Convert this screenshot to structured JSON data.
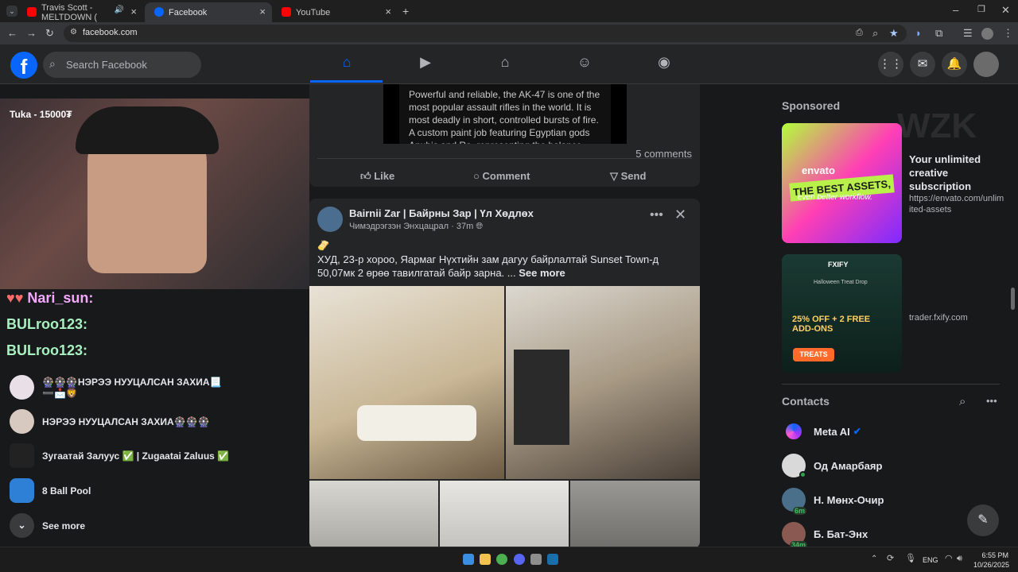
{
  "browser": {
    "tabs": [
      {
        "label": "Travis Scott - MELTDOWN (",
        "favicon_color": "#ff0000"
      },
      {
        "label": "Facebook",
        "favicon_color": "#0866ff"
      },
      {
        "label": "YouTube",
        "favicon_color": "#ff0000"
      }
    ],
    "url": "facebook.com"
  },
  "fb": {
    "logo": "f",
    "search_placeholder": "Search Facebook",
    "accent": "#0866ff"
  },
  "left": {
    "stream_overlay": "Tuka - 15000₮",
    "chat": [
      {
        "user": "Nari_sun:"
      },
      {
        "user": "BULroo123:"
      },
      {
        "user": "BULroo123:"
      }
    ],
    "shortcuts": [
      {
        "label": "🎡🎡🎡НЭРЭЭ НУУЦАЛСАН ЗАХИА📃 ➖📩🦁"
      },
      {
        "label": "НЭРЭЭ НУУЦАЛСАН ЗАХИА🎡🎡🎡"
      },
      {
        "label": "Зугаатай Залуус ✅ | Zugaatai Zaluus ✅"
      },
      {
        "label": "8 Ball Pool"
      }
    ],
    "see_more": "See more"
  },
  "feed": {
    "post1": {
      "desc": "Powerful and reliable, the AK-47 is one of the most popular assault rifles in the world. It is most deadly in short, controlled bursts of fire. A custom paint job featuring Egyptian gods Anubis and Ra, representing the balance",
      "comments": "5 comments",
      "like": "Like",
      "comment": "Comment",
      "send": "Send"
    },
    "post2": {
      "page": "Bairnii Zar | Байрны Зар | Үл Хөдлөх",
      "author": "Чимэдрэгзэн Энхцацрал",
      "time": "37m",
      "emoji": "🫔",
      "text": "ХУД, 23-р хороо, Яармаг Нүхтийн зам дагуу байрлалтай Sunset Town-д 50,07мк 2 өрөө тавилгатай байр зарна. ...",
      "see_more": "See more"
    }
  },
  "right": {
    "sponsored": "Sponsored",
    "ads": [
      {
        "title": "Your unlimited creative subscription",
        "url": "https://envato.com/unlimited-assets",
        "img_top": "envato",
        "img_main": "THE BEST ASSETS,",
        "img_sub": "even better workflow."
      },
      {
        "title": "",
        "url": "trader.fxify.com",
        "img_top": "FXIFY",
        "img_sub": "Halloween Treat Drop",
        "img_main": "25% OFF + 2 FREE ADD-ONS",
        "img_btn": "TREATS"
      }
    ],
    "watermark": "WZK",
    "contacts_title": "Contacts",
    "contacts": [
      {
        "name": "Meta AI",
        "badge": ""
      },
      {
        "name": "Од Амарбаяр",
        "badge": ""
      },
      {
        "name": "Н. Мөнх-Очир",
        "badge": "6m"
      },
      {
        "name": "Б. Бат-Энх",
        "badge": "34m"
      }
    ]
  },
  "taskbar": {
    "lang": "ENG",
    "time": "6:55 PM",
    "date": "10/26/2025"
  }
}
